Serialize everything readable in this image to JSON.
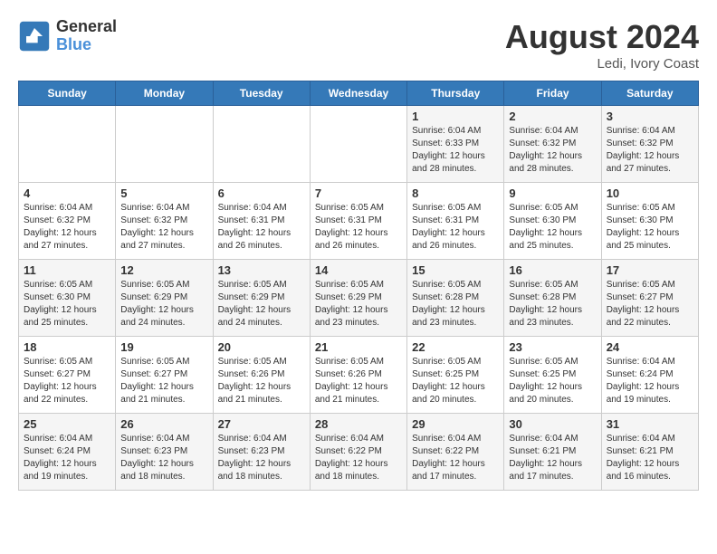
{
  "logo": {
    "line1": "General",
    "line2": "Blue"
  },
  "title": "August 2024",
  "location": "Ledi, Ivory Coast",
  "days_of_week": [
    "Sunday",
    "Monday",
    "Tuesday",
    "Wednesday",
    "Thursday",
    "Friday",
    "Saturday"
  ],
  "weeks": [
    [
      {
        "day": "",
        "info": ""
      },
      {
        "day": "",
        "info": ""
      },
      {
        "day": "",
        "info": ""
      },
      {
        "day": "",
        "info": ""
      },
      {
        "day": "1",
        "info": "Sunrise: 6:04 AM\nSunset: 6:33 PM\nDaylight: 12 hours\nand 28 minutes."
      },
      {
        "day": "2",
        "info": "Sunrise: 6:04 AM\nSunset: 6:32 PM\nDaylight: 12 hours\nand 28 minutes."
      },
      {
        "day": "3",
        "info": "Sunrise: 6:04 AM\nSunset: 6:32 PM\nDaylight: 12 hours\nand 27 minutes."
      }
    ],
    [
      {
        "day": "4",
        "info": "Sunrise: 6:04 AM\nSunset: 6:32 PM\nDaylight: 12 hours\nand 27 minutes."
      },
      {
        "day": "5",
        "info": "Sunrise: 6:04 AM\nSunset: 6:32 PM\nDaylight: 12 hours\nand 27 minutes."
      },
      {
        "day": "6",
        "info": "Sunrise: 6:04 AM\nSunset: 6:31 PM\nDaylight: 12 hours\nand 26 minutes."
      },
      {
        "day": "7",
        "info": "Sunrise: 6:05 AM\nSunset: 6:31 PM\nDaylight: 12 hours\nand 26 minutes."
      },
      {
        "day": "8",
        "info": "Sunrise: 6:05 AM\nSunset: 6:31 PM\nDaylight: 12 hours\nand 26 minutes."
      },
      {
        "day": "9",
        "info": "Sunrise: 6:05 AM\nSunset: 6:30 PM\nDaylight: 12 hours\nand 25 minutes."
      },
      {
        "day": "10",
        "info": "Sunrise: 6:05 AM\nSunset: 6:30 PM\nDaylight: 12 hours\nand 25 minutes."
      }
    ],
    [
      {
        "day": "11",
        "info": "Sunrise: 6:05 AM\nSunset: 6:30 PM\nDaylight: 12 hours\nand 25 minutes."
      },
      {
        "day": "12",
        "info": "Sunrise: 6:05 AM\nSunset: 6:29 PM\nDaylight: 12 hours\nand 24 minutes."
      },
      {
        "day": "13",
        "info": "Sunrise: 6:05 AM\nSunset: 6:29 PM\nDaylight: 12 hours\nand 24 minutes."
      },
      {
        "day": "14",
        "info": "Sunrise: 6:05 AM\nSunset: 6:29 PM\nDaylight: 12 hours\nand 23 minutes."
      },
      {
        "day": "15",
        "info": "Sunrise: 6:05 AM\nSunset: 6:28 PM\nDaylight: 12 hours\nand 23 minutes."
      },
      {
        "day": "16",
        "info": "Sunrise: 6:05 AM\nSunset: 6:28 PM\nDaylight: 12 hours\nand 23 minutes."
      },
      {
        "day": "17",
        "info": "Sunrise: 6:05 AM\nSunset: 6:27 PM\nDaylight: 12 hours\nand 22 minutes."
      }
    ],
    [
      {
        "day": "18",
        "info": "Sunrise: 6:05 AM\nSunset: 6:27 PM\nDaylight: 12 hours\nand 22 minutes."
      },
      {
        "day": "19",
        "info": "Sunrise: 6:05 AM\nSunset: 6:27 PM\nDaylight: 12 hours\nand 21 minutes."
      },
      {
        "day": "20",
        "info": "Sunrise: 6:05 AM\nSunset: 6:26 PM\nDaylight: 12 hours\nand 21 minutes."
      },
      {
        "day": "21",
        "info": "Sunrise: 6:05 AM\nSunset: 6:26 PM\nDaylight: 12 hours\nand 21 minutes."
      },
      {
        "day": "22",
        "info": "Sunrise: 6:05 AM\nSunset: 6:25 PM\nDaylight: 12 hours\nand 20 minutes."
      },
      {
        "day": "23",
        "info": "Sunrise: 6:05 AM\nSunset: 6:25 PM\nDaylight: 12 hours\nand 20 minutes."
      },
      {
        "day": "24",
        "info": "Sunrise: 6:04 AM\nSunset: 6:24 PM\nDaylight: 12 hours\nand 19 minutes."
      }
    ],
    [
      {
        "day": "25",
        "info": "Sunrise: 6:04 AM\nSunset: 6:24 PM\nDaylight: 12 hours\nand 19 minutes."
      },
      {
        "day": "26",
        "info": "Sunrise: 6:04 AM\nSunset: 6:23 PM\nDaylight: 12 hours\nand 18 minutes."
      },
      {
        "day": "27",
        "info": "Sunrise: 6:04 AM\nSunset: 6:23 PM\nDaylight: 12 hours\nand 18 minutes."
      },
      {
        "day": "28",
        "info": "Sunrise: 6:04 AM\nSunset: 6:22 PM\nDaylight: 12 hours\nand 18 minutes."
      },
      {
        "day": "29",
        "info": "Sunrise: 6:04 AM\nSunset: 6:22 PM\nDaylight: 12 hours\nand 17 minutes."
      },
      {
        "day": "30",
        "info": "Sunrise: 6:04 AM\nSunset: 6:21 PM\nDaylight: 12 hours\nand 17 minutes."
      },
      {
        "day": "31",
        "info": "Sunrise: 6:04 AM\nSunset: 6:21 PM\nDaylight: 12 hours\nand 16 minutes."
      }
    ]
  ]
}
